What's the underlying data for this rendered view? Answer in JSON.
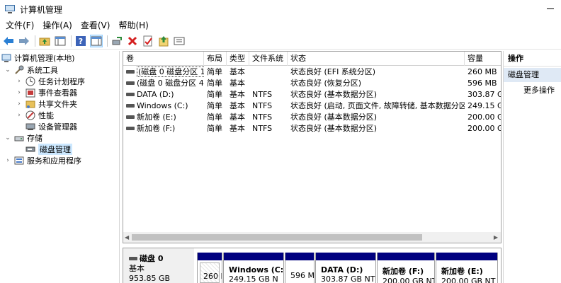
{
  "window": {
    "title": "计算机管理"
  },
  "menu": [
    "文件(F)",
    "操作(A)",
    "查看(V)",
    "帮助(H)"
  ],
  "toolbar": {
    "icons": [
      "back-arrow-icon",
      "forward-arrow-icon",
      "up-folder-icon",
      "show-hide-tree-icon",
      "help-icon",
      "console-view-icon",
      "connect-icon",
      "delete-icon",
      "properties-icon",
      "import-icon",
      "export-list-icon"
    ]
  },
  "tree": {
    "root": "计算机管理(本地)",
    "items": [
      {
        "label": "系统工具"
      },
      {
        "label": "任务计划程序"
      },
      {
        "label": "事件查看器"
      },
      {
        "label": "共享文件夹"
      },
      {
        "label": "性能"
      },
      {
        "label": "设备管理器"
      },
      {
        "label": "存储"
      },
      {
        "label": "磁盘管理"
      },
      {
        "label": "服务和应用程序"
      }
    ]
  },
  "volumes": {
    "columns": [
      "卷",
      "布局",
      "类型",
      "文件系统",
      "状态",
      "容量"
    ],
    "rows": [
      [
        "(磁盘 0 磁盘分区 1)",
        "简单",
        "基本",
        "",
        "状态良好 (EFI 系统分区)",
        "260 MB"
      ],
      [
        "(磁盘 0 磁盘分区 4)",
        "简单",
        "基本",
        "",
        "状态良好 (恢复分区)",
        "596 MB"
      ],
      [
        "DATA (D:)",
        "简单",
        "基本",
        "NTFS",
        "状态良好 (基本数据分区)",
        "303.87 G"
      ],
      [
        "Windows (C:)",
        "简单",
        "基本",
        "NTFS",
        "状态良好 (启动, 页面文件, 故障转储, 基本数据分区)",
        "249.15 G"
      ],
      [
        "新加卷 (E:)",
        "简单",
        "基本",
        "NTFS",
        "状态良好 (基本数据分区)",
        "200.00 G"
      ],
      [
        "新加卷 (F:)",
        "简单",
        "基本",
        "NTFS",
        "状态良好 (基本数据分区)",
        "200.00 G"
      ]
    ]
  },
  "disk": {
    "name": "磁盘 0",
    "type": "基本",
    "size": "953.85 GB",
    "partitions": [
      {
        "name": "",
        "size": "260 I"
      },
      {
        "name": "Windows (C:",
        "size": "249.15 GB N"
      },
      {
        "name": "",
        "size": "596 M"
      },
      {
        "name": "DATA (D:)",
        "size": "303.87 GB NTF"
      },
      {
        "name": "新加卷 (F:)",
        "size": "200.00 GB NT"
      },
      {
        "name": "新加卷 (E:)",
        "size": "200.00 GB NT"
      }
    ]
  },
  "actions": {
    "header": "操作",
    "section": "磁盘管理",
    "more": "更多操作"
  },
  "colors": {
    "partition_bar": "#00007f",
    "selection": "#cce8ff",
    "action_section": "#dfe9f5"
  }
}
